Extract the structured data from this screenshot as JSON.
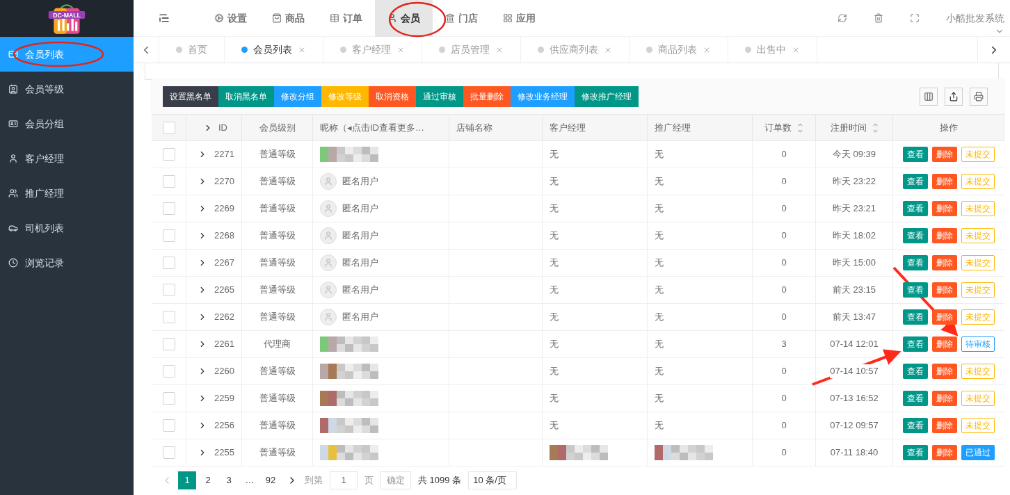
{
  "logo": {
    "text": "DC-MALL"
  },
  "sidebar": {
    "items": [
      {
        "label": "会员列表",
        "selected": true
      },
      {
        "label": "会员等级",
        "selected": false
      },
      {
        "label": "会员分组",
        "selected": false
      },
      {
        "label": "客户经理",
        "selected": false
      },
      {
        "label": "推广经理",
        "selected": false
      },
      {
        "label": "司机列表",
        "selected": false
      },
      {
        "label": "浏览记录",
        "selected": false
      }
    ]
  },
  "top_menu": [
    {
      "label": "设置",
      "selected": false
    },
    {
      "label": "商品",
      "selected": false
    },
    {
      "label": "订单",
      "selected": false
    },
    {
      "label": "会员",
      "selected": true
    },
    {
      "label": "门店",
      "selected": false
    },
    {
      "label": "应用",
      "selected": false
    }
  ],
  "user_menu": {
    "label": "小酷批发系统"
  },
  "page_tabs": [
    {
      "label": "首页",
      "selected": false,
      "closable": false
    },
    {
      "label": "会员列表",
      "selected": true,
      "closable": true
    },
    {
      "label": "客户经理",
      "selected": false,
      "closable": true
    },
    {
      "label": "店员管理",
      "selected": false,
      "closable": true
    },
    {
      "label": "供应商列表",
      "selected": false,
      "closable": true
    },
    {
      "label": "商品列表",
      "selected": false,
      "closable": true
    },
    {
      "label": "出售中",
      "selected": false,
      "closable": true
    }
  ],
  "toolbar": [
    {
      "label": "设置黑名单",
      "color": "#393d49"
    },
    {
      "label": "取消黑名单",
      "color": "#009688"
    },
    {
      "label": "修改分组",
      "color": "#1e9fff"
    },
    {
      "label": "修改等级",
      "color": "#ffb800"
    },
    {
      "label": "取消资格",
      "color": "#ff5722"
    },
    {
      "label": "通过审核",
      "color": "#009688"
    },
    {
      "label": "批量删除",
      "color": "#ff5722"
    },
    {
      "label": "修改业务经理",
      "color": "#1e9fff"
    },
    {
      "label": "修改推广经理",
      "color": "#009688"
    }
  ],
  "table": {
    "all_checked": false,
    "columns": [
      {
        "label": "ID",
        "sortable": false
      },
      {
        "label": "会员级别",
        "sortable": false
      },
      {
        "label": "昵称（◂点击ID查看更多…",
        "sortable": false
      },
      {
        "label": "店铺名称",
        "sortable": false
      },
      {
        "label": "客户经理",
        "sortable": false
      },
      {
        "label": "推广经理",
        "sortable": false
      },
      {
        "label": "订单数",
        "sortable": true
      },
      {
        "label": "注册时间",
        "sortable": true
      },
      {
        "label": "操作",
        "sortable": false
      }
    ],
    "rows": [
      {
        "checked": false,
        "id": "2271",
        "level": "普通等级",
        "nickname": {
          "kind": "blurred"
        },
        "customer_manager": {
          "kind": "text",
          "text": "无"
        },
        "promo_manager": {
          "kind": "text",
          "text": "无"
        },
        "orders": "0",
        "registered": "今天 09:39",
        "actions": [
          "查看",
          "删除"
        ],
        "status": {
          "kind": "unsubmitted",
          "label": "未提交"
        }
      },
      {
        "checked": false,
        "id": "2270",
        "level": "普通等级",
        "nickname": {
          "kind": "anonymous",
          "text": "匿名用户"
        },
        "customer_manager": {
          "kind": "text",
          "text": "无"
        },
        "promo_manager": {
          "kind": "text",
          "text": "无"
        },
        "orders": "0",
        "registered": "昨天 23:22",
        "actions": [
          "查看",
          "删除"
        ],
        "status": {
          "kind": "unsubmitted",
          "label": "未提交"
        }
      },
      {
        "checked": false,
        "id": "2269",
        "level": "普通等级",
        "nickname": {
          "kind": "anonymous",
          "text": "匿名用户"
        },
        "customer_manager": {
          "kind": "text",
          "text": "无"
        },
        "promo_manager": {
          "kind": "text",
          "text": "无"
        },
        "orders": "0",
        "registered": "昨天 23:21",
        "actions": [
          "查看",
          "删除"
        ],
        "status": {
          "kind": "unsubmitted",
          "label": "未提交"
        }
      },
      {
        "checked": false,
        "id": "2268",
        "level": "普通等级",
        "nickname": {
          "kind": "anonymous",
          "text": "匿名用户"
        },
        "customer_manager": {
          "kind": "text",
          "text": "无"
        },
        "promo_manager": {
          "kind": "text",
          "text": "无"
        },
        "orders": "0",
        "registered": "昨天 18:02",
        "actions": [
          "查看",
          "删除"
        ],
        "status": {
          "kind": "unsubmitted",
          "label": "未提交"
        }
      },
      {
        "checked": false,
        "id": "2267",
        "level": "普通等级",
        "nickname": {
          "kind": "anonymous",
          "text": "匿名用户"
        },
        "customer_manager": {
          "kind": "text",
          "text": "无"
        },
        "promo_manager": {
          "kind": "text",
          "text": "无"
        },
        "orders": "0",
        "registered": "昨天 15:00",
        "actions": [
          "查看",
          "删除"
        ],
        "status": {
          "kind": "unsubmitted",
          "label": "未提交"
        }
      },
      {
        "checked": false,
        "id": "2265",
        "level": "普通等级",
        "nickname": {
          "kind": "anonymous",
          "text": "匿名用户"
        },
        "customer_manager": {
          "kind": "text",
          "text": "无"
        },
        "promo_manager": {
          "kind": "text",
          "text": "无"
        },
        "orders": "0",
        "registered": "前天 23:15",
        "actions": [
          "查看",
          "删除"
        ],
        "status": {
          "kind": "unsubmitted",
          "label": "未提交"
        }
      },
      {
        "checked": false,
        "id": "2262",
        "level": "普通等级",
        "nickname": {
          "kind": "anonymous",
          "text": "匿名用户"
        },
        "customer_manager": {
          "kind": "text",
          "text": "无"
        },
        "promo_manager": {
          "kind": "text",
          "text": "无"
        },
        "orders": "0",
        "registered": "前天 13:47",
        "actions": [
          "查看",
          "删除"
        ],
        "status": {
          "kind": "unsubmitted",
          "label": "未提交"
        }
      },
      {
        "checked": false,
        "id": "2261",
        "level": "代理商",
        "nickname": {
          "kind": "blurred"
        },
        "customer_manager": {
          "kind": "text",
          "text": "无"
        },
        "promo_manager": {
          "kind": "text",
          "text": "无"
        },
        "orders": "3",
        "registered": "07-14 12:01",
        "actions": [
          "查看",
          "删除"
        ],
        "status": {
          "kind": "pending",
          "label": "待审核"
        }
      },
      {
        "checked": false,
        "id": "2260",
        "level": "普通等级",
        "nickname": {
          "kind": "blurred"
        },
        "customer_manager": {
          "kind": "text",
          "text": "无"
        },
        "promo_manager": {
          "kind": "text",
          "text": "无"
        },
        "orders": "0",
        "registered": "07-14 10:57",
        "actions": [
          "查看",
          "删除"
        ],
        "status": {
          "kind": "unsubmitted",
          "label": "未提交"
        }
      },
      {
        "checked": false,
        "id": "2259",
        "level": "普通等级",
        "nickname": {
          "kind": "blurred"
        },
        "customer_manager": {
          "kind": "text",
          "text": "无"
        },
        "promo_manager": {
          "kind": "text",
          "text": "无"
        },
        "orders": "0",
        "registered": "07-13 16:52",
        "actions": [
          "查看",
          "删除"
        ],
        "status": {
          "kind": "unsubmitted",
          "label": "未提交"
        }
      },
      {
        "checked": false,
        "id": "2256",
        "level": "普通等级",
        "nickname": {
          "kind": "blurred"
        },
        "customer_manager": {
          "kind": "text",
          "text": "无"
        },
        "promo_manager": {
          "kind": "text",
          "text": "无"
        },
        "orders": "0",
        "registered": "07-12 09:57",
        "actions": [
          "查看",
          "删除"
        ],
        "status": {
          "kind": "unsubmitted",
          "label": "未提交"
        }
      },
      {
        "checked": false,
        "id": "2255",
        "level": "普通等级",
        "nickname": {
          "kind": "blurred"
        },
        "customer_manager": {
          "kind": "blurred"
        },
        "promo_manager": {
          "kind": "blurred"
        },
        "orders": "0",
        "registered": "07-11 18:40",
        "actions": [
          "查看",
          "删除"
        ],
        "status": {
          "kind": "approved",
          "label": "已通过"
        }
      }
    ]
  },
  "pagination": {
    "pages": [
      {
        "label": "1",
        "selected": true
      },
      {
        "label": "2",
        "selected": false
      },
      {
        "label": "3",
        "selected": false
      },
      {
        "label": "…",
        "selected": false
      },
      {
        "label": "92",
        "selected": false
      }
    ],
    "goto_label": "到第",
    "goto_value": "1",
    "page_unit": "页",
    "confirm": "确定",
    "total": "共 1099 条",
    "page_size": "10 条/页"
  }
}
